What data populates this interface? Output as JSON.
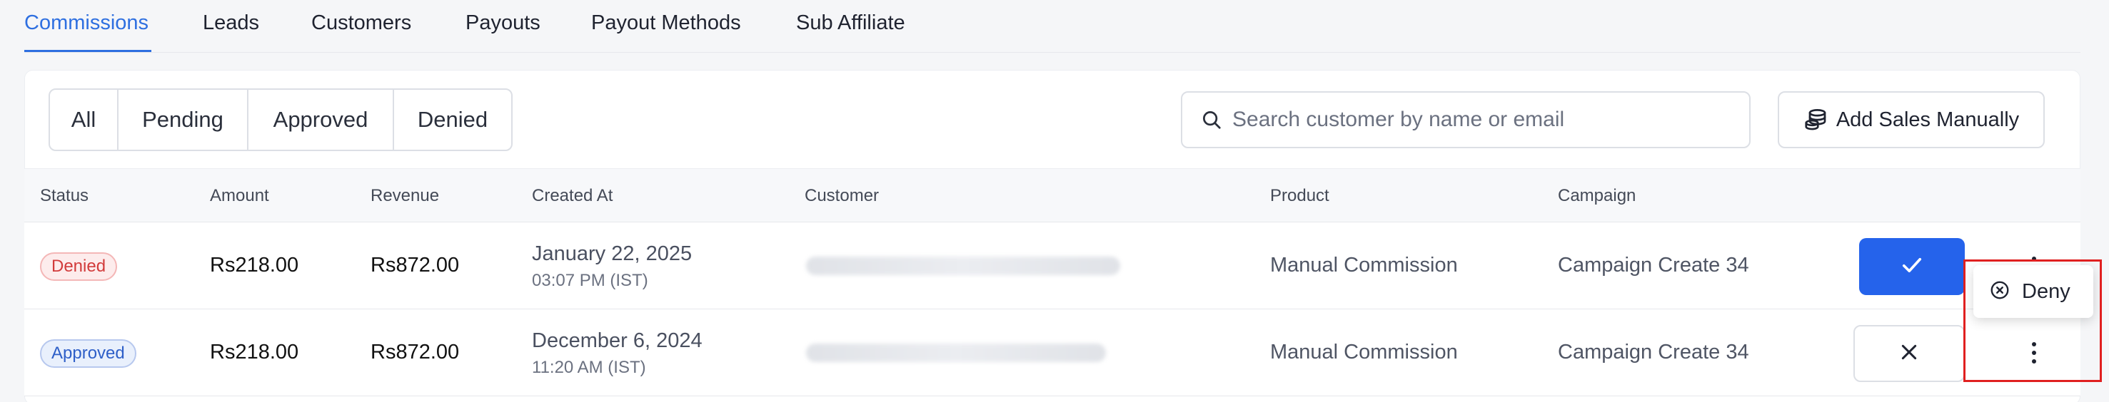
{
  "tabs": [
    "Commissions",
    "Leads",
    "Customers",
    "Payouts",
    "Payout Methods",
    "Sub Affiliate"
  ],
  "filters": [
    "All",
    "Pending",
    "Approved",
    "Denied"
  ],
  "search": {
    "placeholder": "Search customer by name or email"
  },
  "add_sales_label": "Add Sales Manually",
  "columns": [
    "Status",
    "Amount",
    "Revenue",
    "Created At",
    "Customer",
    "Product",
    "Campaign"
  ],
  "rows": [
    {
      "status": "Denied",
      "amount": "Rs218.00",
      "revenue": "Rs872.00",
      "date": "January 22, 2025",
      "time": "03:07 PM (IST)",
      "product": "Manual Commission",
      "campaign": "Campaign Create 34"
    },
    {
      "status": "Approved",
      "amount": "Rs218.00",
      "revenue": "Rs872.00",
      "date": "December 6, 2024",
      "time": "11:20 AM (IST)",
      "product": "Manual Commission",
      "campaign": "Campaign Create 34"
    }
  ],
  "menu": {
    "deny_label": "Deny"
  },
  "colors": {
    "accent": "#2e6fe0",
    "approve": "#2563eb",
    "denied": "#d23b3b",
    "approved": "#2e5fc8",
    "highlight": "#e02020"
  },
  "icons": [
    "search-icon",
    "coins-icon",
    "check-icon",
    "close-icon",
    "kebab-icon",
    "circle-x-icon"
  ]
}
